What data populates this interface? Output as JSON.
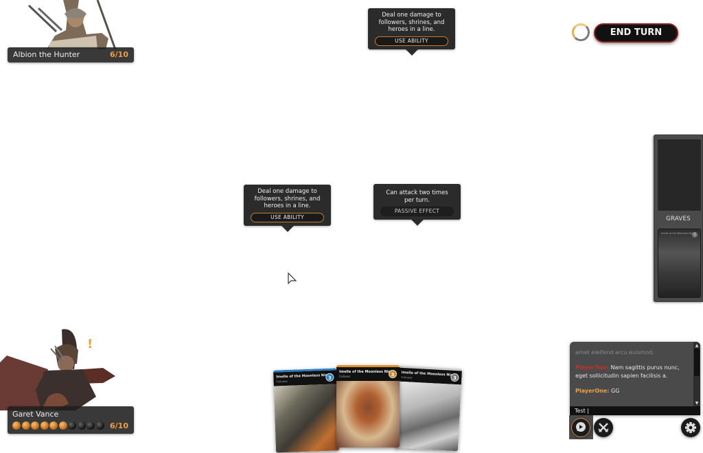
{
  "opponent_hero": {
    "name": "Albion the Hunter",
    "health": "6/10"
  },
  "player_hero": {
    "name": "Garet Vance",
    "health": "6/10",
    "resources_filled": 6,
    "resources_total": 10,
    "alert_icon": "!"
  },
  "end_turn": {
    "label": "END TURN",
    "timer_icon": "turn-timer-icon"
  },
  "tooltips": [
    {
      "text": "Deal one damage to followers, shrines, and heroes in a line.",
      "button": "USE ABILITY",
      "active": true
    },
    {
      "text": "Deal one damage to followers, shrines, and heroes in a line.",
      "button": "USE ABILITY",
      "active": true
    },
    {
      "text": "Can attack two times per turn.",
      "button": "PASSIVE EFFECT",
      "active": false
    }
  ],
  "graves": {
    "label": "GRAVES",
    "top_card": {
      "title": "Imelle of the Moonless Night",
      "cost": "3"
    }
  },
  "hand": [
    {
      "title": "Imelle of the Moonless Night",
      "type": "Follower",
      "cost": "3",
      "color": "#2a7fc4"
    },
    {
      "title": "Imelle of the Moonless Night",
      "type": "Follower",
      "cost": "3",
      "color": "#e0902a"
    },
    {
      "title": "Imelle of the Moonless Night",
      "type": "Follower",
      "cost": "3",
      "color": "#aaaaaa"
    }
  ],
  "chat": {
    "messages": [
      {
        "sender": "",
        "text": "amet eleifend arcu euismod."
      },
      {
        "sender": "PlayerTwo:",
        "text": " Nam sagittis purus nunc, eget sollicitudin sapien facilisis a."
      },
      {
        "sender": "PlayerOne:",
        "text": " GG"
      }
    ],
    "input_value": "Test |",
    "scroll_up": "▲",
    "scroll_down": "▼"
  },
  "bottom_buttons": {
    "chat": "chat-icon",
    "surrender": "crossed-swords-icon",
    "settings": "gear-icon"
  }
}
